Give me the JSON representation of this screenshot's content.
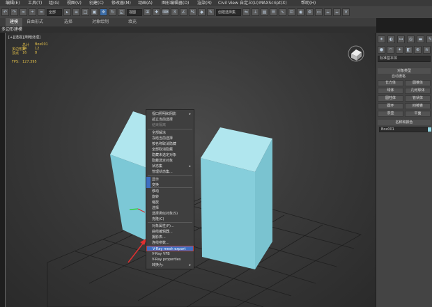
{
  "menubar": {
    "items": [
      "编辑(E)",
      "工具(T)",
      "组(G)",
      "视图(V)",
      "创建(C)",
      "修改器(M)",
      "动画(A)",
      "图形编辑器(D)",
      "渲染(R)",
      "Civil View",
      "自定义(U)",
      "MAXScript(X)",
      "帮助(H)"
    ]
  },
  "toolbar": {
    "selection_filter": "全部",
    "view_dropdown": "视图",
    "named_selection": "创建选择集"
  },
  "ribbon": {
    "tabs": [
      "建模",
      "自由形式",
      "选择",
      "对象绘制",
      "填充"
    ]
  },
  "polybar": {
    "label": "多边形建模"
  },
  "viewport": {
    "label": "[+][透视][明暗处理]",
    "stats": {
      "total_label": "总计",
      "total_value": "Box001",
      "poly_label": "多边形数",
      "poly_a": "24",
      "poly_b": "12",
      "vert_label": "顶点",
      "vert_a": "16",
      "vert_b": "8",
      "fps_label": "FPS:",
      "fps_value": "127.395"
    }
  },
  "context_menu": {
    "items": [
      {
        "label": "视口照明和阴影",
        "dim": false,
        "arrow": true
      },
      {
        "label": "孤立当前选择",
        "dim": false,
        "arrow": false
      },
      {
        "label": "结束隔离",
        "dim": true,
        "arrow": false
      },
      {
        "label": "全部解冻",
        "dim": false,
        "arrow": false
      },
      {
        "label": "冻结当前选择",
        "dim": false,
        "arrow": false
      },
      {
        "label": "按名称取消隐藏",
        "dim": false,
        "arrow": false
      },
      {
        "label": "全部取消隐藏",
        "dim": false,
        "arrow": false
      },
      {
        "label": "隐藏未选定对象",
        "dim": false,
        "arrow": false
      },
      {
        "label": "隐藏选定对象",
        "dim": false,
        "arrow": false
      },
      {
        "label": "状态集",
        "dim": false,
        "arrow": true
      },
      {
        "label": "管理状态集...",
        "dim": false,
        "arrow": false
      },
      {
        "label": "显示",
        "dim": false,
        "arrow": false
      },
      {
        "label": "变换",
        "dim": false,
        "arrow": false
      },
      {
        "label": "移动",
        "dim": false,
        "arrow": false
      },
      {
        "label": "旋转",
        "dim": false,
        "arrow": false
      },
      {
        "label": "缩放",
        "dim": false,
        "arrow": false
      },
      {
        "label": "选择",
        "dim": false,
        "arrow": false
      },
      {
        "label": "选择类似对象(S)",
        "dim": false,
        "arrow": false
      },
      {
        "label": "克隆(C)",
        "dim": false,
        "arrow": false
      },
      {
        "label": "对象属性(P)...",
        "dim": false,
        "arrow": false
      },
      {
        "label": "曲线编辑器...",
        "dim": false,
        "arrow": false
      },
      {
        "label": "摄影表...",
        "dim": false,
        "arrow": false
      },
      {
        "label": "连线参数...",
        "dim": false,
        "arrow": false
      },
      {
        "label": "V-Ray mesh export",
        "dim": false,
        "arrow": false,
        "highlight": true
      },
      {
        "label": "V-Ray VFB",
        "dim": false,
        "arrow": false
      },
      {
        "label": "V-Ray properties",
        "dim": false,
        "arrow": false
      },
      {
        "label": "转换为:",
        "dim": false,
        "arrow": true
      }
    ]
  },
  "command_panel": {
    "category": "标准基本体",
    "rollout_object_type": "对象类型",
    "autogrid": "自动栅格",
    "buttons": [
      "长方体",
      "圆锥体",
      "球体",
      "几何球体",
      "圆柱体",
      "管状体",
      "圆环",
      "四棱锥",
      "茶壶",
      "平面"
    ],
    "rollout_name_color": "名称和颜色",
    "object_name": "Box001"
  },
  "colors": {
    "box": "#8fd4e0",
    "highlight": "#3d6fc2",
    "arrow": "#e03030"
  }
}
